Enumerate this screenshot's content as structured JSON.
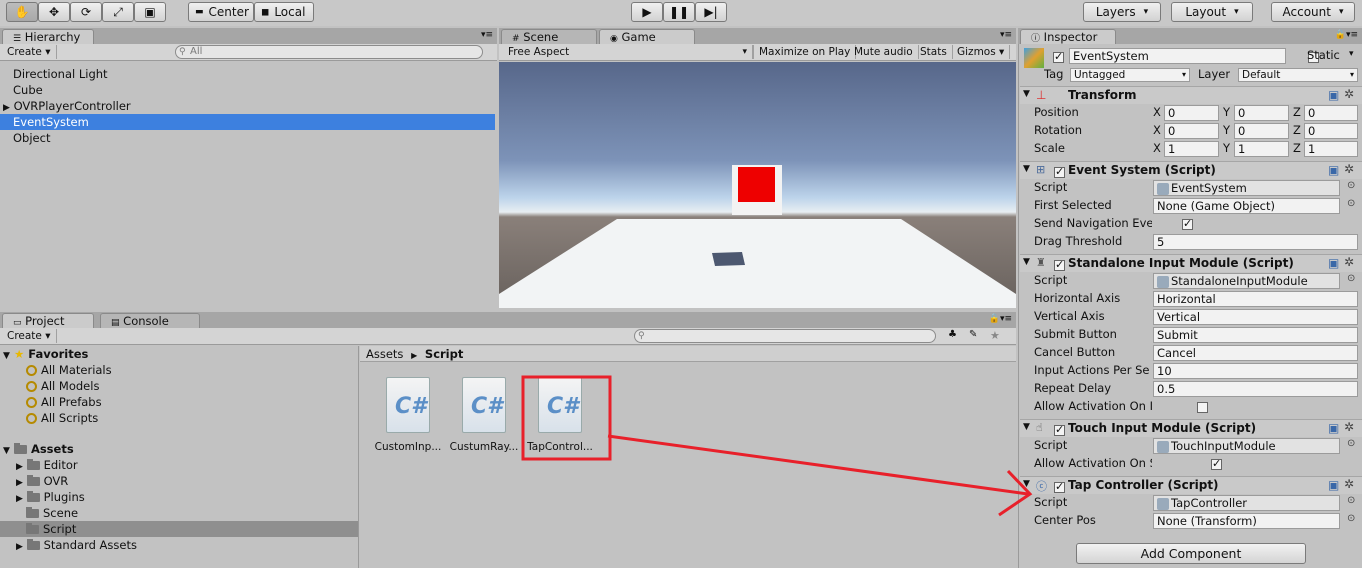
{
  "toolbar": {
    "tools": [
      "hand-icon",
      "move-icon",
      "rotate-icon",
      "scale-icon",
      "rect-icon"
    ],
    "center": "Center",
    "local": "Local",
    "layers": "Layers",
    "layout": "Layout",
    "account": "Account"
  },
  "hierarchy": {
    "tab": "Hierarchy",
    "create": "Create",
    "search_placeholder": "All",
    "items": [
      "Directional Light",
      "Cube",
      "OVRPlayerController",
      "EventSystem",
      "Object"
    ],
    "selected": "EventSystem"
  },
  "game": {
    "scene_tab": "Scene",
    "game_tab": "Game",
    "aspect": "Free Aspect",
    "maximize": "Maximize on Play",
    "mute": "Mute audio",
    "stats": "Stats",
    "gizmos": "Gizmos"
  },
  "project": {
    "tab": "Project",
    "console_tab": "Console",
    "create": "Create",
    "favorites_label": "Favorites",
    "favorites": [
      "All Materials",
      "All Models",
      "All Prefabs",
      "All Scripts"
    ],
    "assets_label": "Assets",
    "assets": [
      "Editor",
      "OVR",
      "Plugins",
      "Scene",
      "Script",
      "Standard Assets"
    ],
    "selected_folder": "Script",
    "breadcrumb_root": "Assets",
    "breadcrumb_current": "Script",
    "files": [
      "CustomInp...",
      "CustumRay...",
      "TapControl..."
    ],
    "file_glyph": "C#"
  },
  "inspector": {
    "tab": "Inspector",
    "object_name": "EventSystem",
    "static_label": "Static",
    "tag_label": "Tag",
    "tag_value": "Untagged",
    "layer_label": "Layer",
    "layer_value": "Default",
    "transform": {
      "title": "Transform",
      "position_label": "Position",
      "rotation_label": "Rotation",
      "scale_label": "Scale",
      "axis": [
        "X",
        "Y",
        "Z"
      ],
      "position": [
        "0",
        "0",
        "0"
      ],
      "rotation": [
        "0",
        "0",
        "0"
      ],
      "scale": [
        "1",
        "1",
        "1"
      ]
    },
    "event_system": {
      "title": "Event System (Script)",
      "script_label": "Script",
      "script_value": "EventSystem",
      "first_selected_label": "First Selected",
      "first_selected_value": "None (Game Object)",
      "send_nav_label": "Send Navigation Eve",
      "drag_label": "Drag Threshold",
      "drag_value": "5"
    },
    "standalone": {
      "title": "Standalone Input Module (Script)",
      "script_label": "Script",
      "script_value": "StandaloneInputModule",
      "h_axis_label": "Horizontal Axis",
      "h_axis_value": "Horizontal",
      "v_axis_label": "Vertical Axis",
      "v_axis_value": "Vertical",
      "submit_label": "Submit Button",
      "submit_value": "Submit",
      "cancel_label": "Cancel Button",
      "cancel_value": "Cancel",
      "iaps_label": "Input Actions Per Se",
      "iaps_value": "10",
      "repeat_label": "Repeat Delay",
      "repeat_value": "0.5",
      "allow_label": "Allow Activation On I"
    },
    "touch": {
      "title": "Touch Input Module (Script)",
      "script_label": "Script",
      "script_value": "TouchInputModule",
      "allow_label": "Allow Activation On S"
    },
    "tap": {
      "title": "Tap Controller (Script)",
      "script_label": "Script",
      "script_value": "TapController",
      "center_label": "Center Pos",
      "center_value": "None (Transform)"
    },
    "add_component": "Add Component"
  },
  "colors": {
    "selection": "#3d80df",
    "annotation": "#e8202a",
    "red_cube": "#ee0000"
  }
}
